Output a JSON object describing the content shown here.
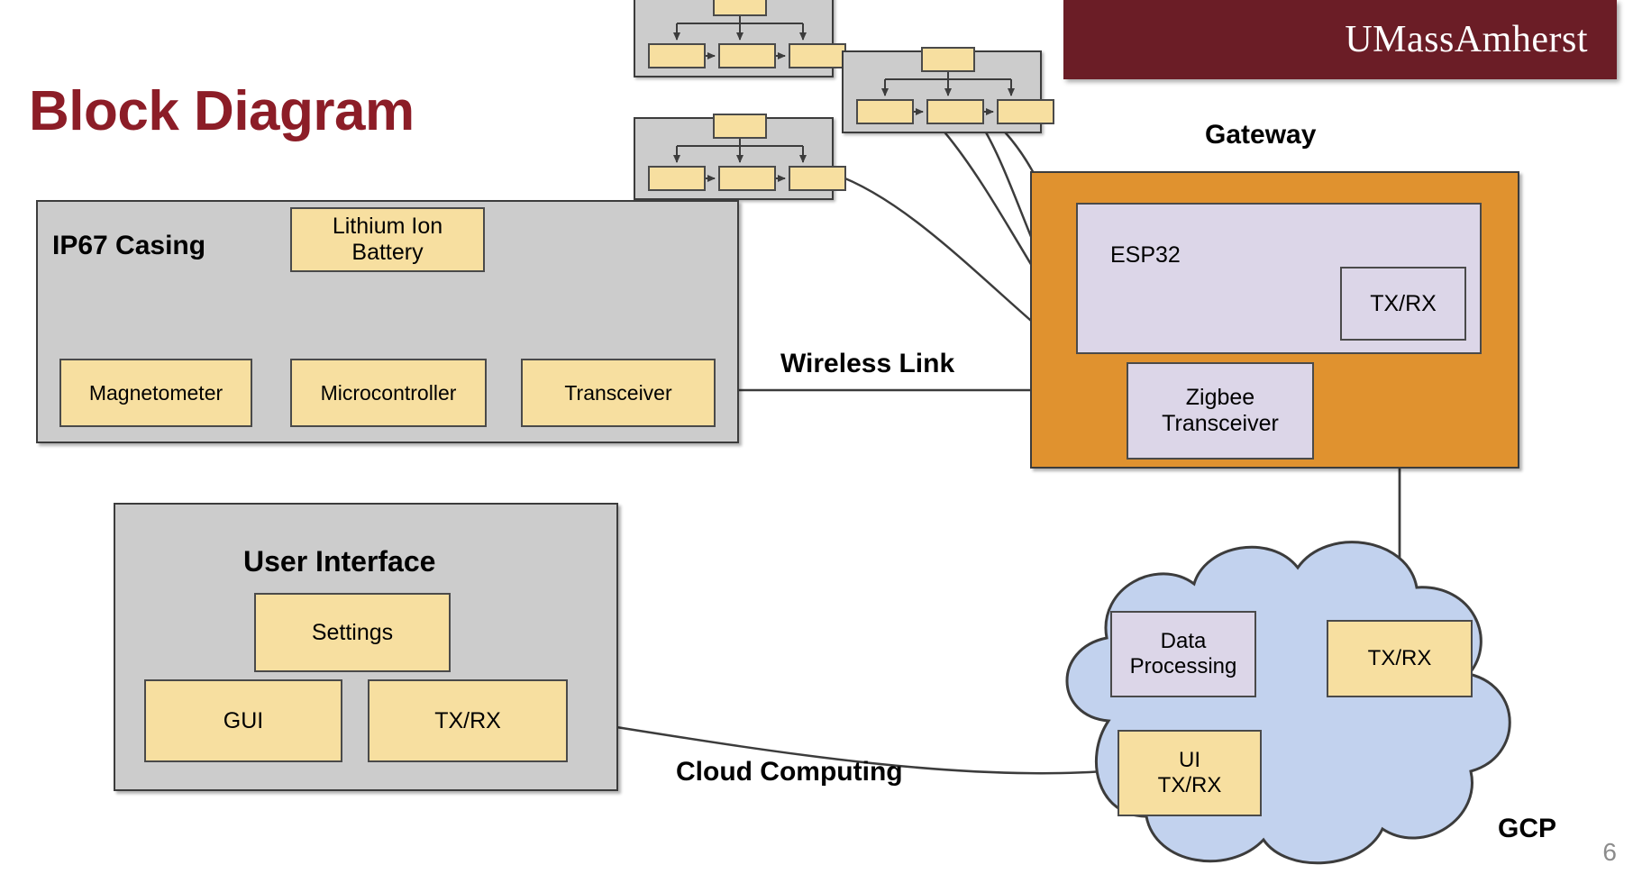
{
  "branding": {
    "wordmark": "UMassAmherst",
    "banner_color": "#6b1d26"
  },
  "title": "Block Diagram",
  "title_color": "#8c1d27",
  "page_number": "6",
  "palette": {
    "gray_group": "#cccccc",
    "yellow_block": "#f7dfa0",
    "lavender_block": "#dcd6e8",
    "orange_group": "#e0922f",
    "cloud_blue": "#c2d2ee",
    "stroke": "#3c3c3c"
  },
  "sensor_node": {
    "label": "IP67 Casing",
    "blocks": {
      "battery": "Lithium Ion\nBattery",
      "battery_line1": "Lithium Ion",
      "battery_line2": "Battery",
      "magnetometer": "Magnetometer",
      "microcontroller": "Microcontroller",
      "transceiver": "Transceiver"
    }
  },
  "replicas": {
    "count": 3,
    "description": "miniature unlabeled copies of the IP67 sensor node"
  },
  "links": {
    "wireless": "Wireless Link",
    "cloud": "Cloud Computing"
  },
  "gateway": {
    "label": "Gateway",
    "esp32": "ESP32",
    "esp32_txrx": "TX/RX",
    "zigbee_line1": "Zigbee",
    "zigbee_line2": "Transceiver"
  },
  "cloud": {
    "label": "GCP",
    "data_processing_line1": "Data",
    "data_processing_line2": "Processing",
    "txrx": "TX/RX",
    "ui_txrx_line1": "UI",
    "ui_txrx_line2": "TX/RX"
  },
  "user_interface": {
    "label": "User Interface",
    "settings": "Settings",
    "gui": "GUI",
    "txrx": "TX/RX"
  }
}
